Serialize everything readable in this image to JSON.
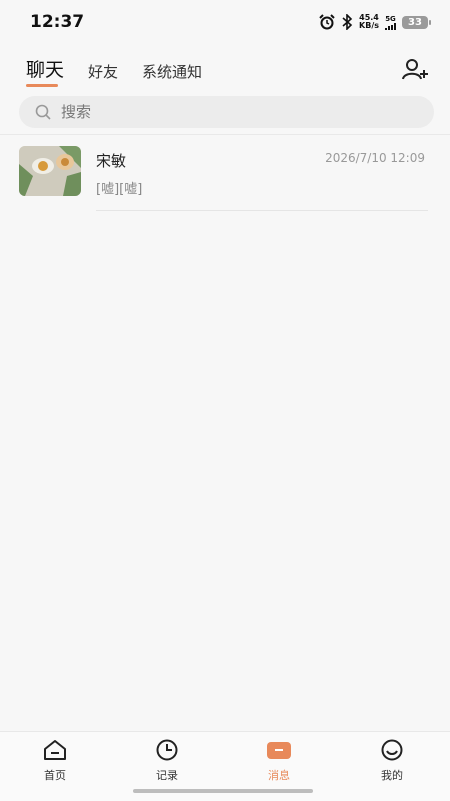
{
  "status_bar": {
    "time": "12:37",
    "speed_value": "45.4",
    "speed_unit": "KB/s",
    "network": "5G",
    "battery": "33"
  },
  "header": {
    "tabs": [
      {
        "label": "聊天",
        "active": true
      },
      {
        "label": "好友",
        "active": false
      },
      {
        "label": "系统通知",
        "active": false
      }
    ],
    "add_friend_icon": "add-user-icon"
  },
  "search": {
    "placeholder": "搜索",
    "icon": "search-icon"
  },
  "conversations": [
    {
      "name": "宋敏",
      "time": "2026/7/10 12:09",
      "preview": "[嘘][嘘]"
    }
  ],
  "bottom_nav": [
    {
      "label": "首页",
      "icon": "home-icon",
      "active": false
    },
    {
      "label": "记录",
      "icon": "clock-icon",
      "active": false
    },
    {
      "label": "消息",
      "icon": "message-icon",
      "active": true
    },
    {
      "label": "我的",
      "icon": "smile-icon",
      "active": false
    }
  ],
  "colors": {
    "accent": "#e8895a",
    "background": "#f7f7f7",
    "search_bg": "#ececec"
  }
}
